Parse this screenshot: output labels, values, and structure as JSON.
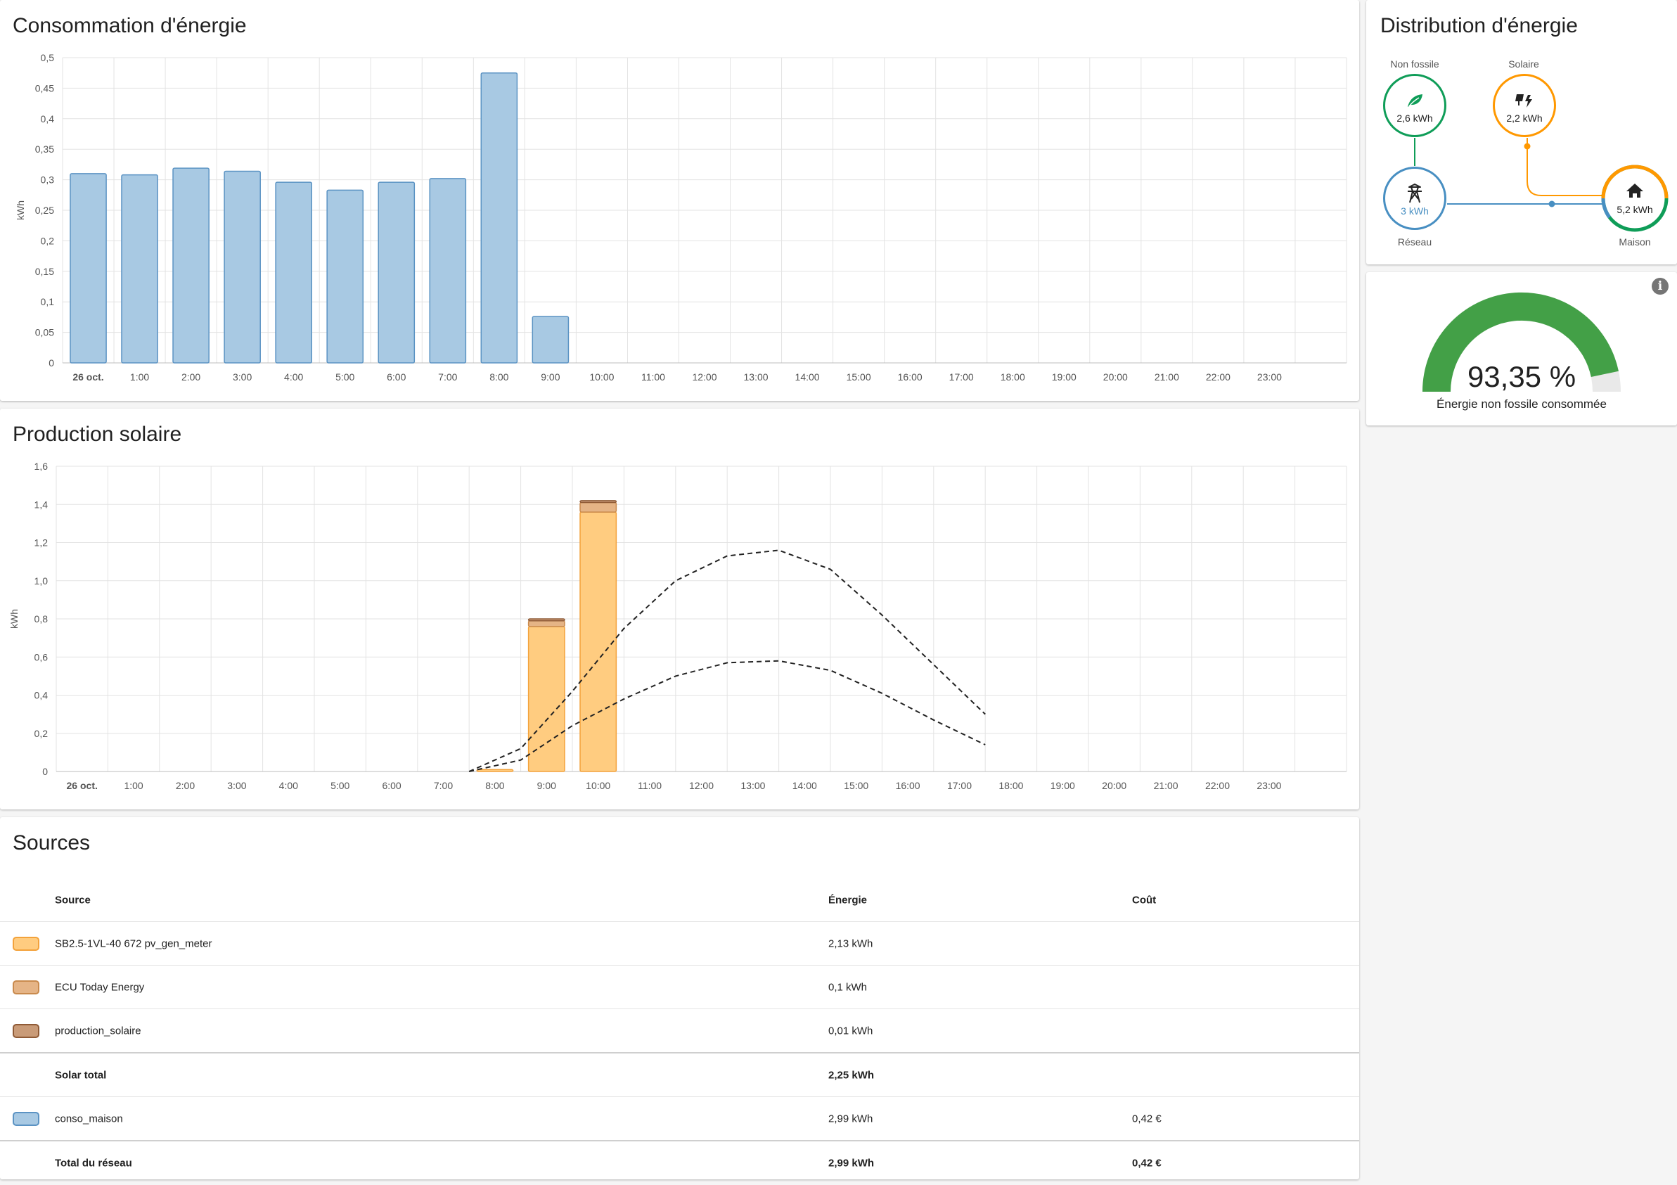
{
  "consumption": {
    "title": "Consommation d'énergie",
    "chart_data": {
      "type": "bar",
      "ylabel": "kWh",
      "ylim": [
        0,
        0.5
      ],
      "yticks": [
        "0",
        "0,05",
        "0,1",
        "0,15",
        "0,2",
        "0,25",
        "0,3",
        "0,35",
        "0,4",
        "0,45",
        "0,5"
      ],
      "categories": [
        "26 oct.",
        "1:00",
        "2:00",
        "3:00",
        "4:00",
        "5:00",
        "6:00",
        "7:00",
        "8:00",
        "9:00",
        "10:00",
        "11:00",
        "12:00",
        "13:00",
        "14:00",
        "15:00",
        "16:00",
        "17:00",
        "18:00",
        "19:00",
        "20:00",
        "21:00",
        "22:00",
        "23:00"
      ],
      "series": [
        {
          "name": "conso_maison",
          "values": [
            0.31,
            0.308,
            0.319,
            0.314,
            0.296,
            0.283,
            0.296,
            0.302,
            0.475,
            0.076,
            null,
            null,
            null,
            null,
            null,
            null,
            null,
            null,
            null,
            null,
            null,
            null,
            null,
            null
          ]
        }
      ],
      "grid": true,
      "colors": {
        "fill": "#a8c9e3",
        "stroke": "#5b93c3"
      }
    }
  },
  "solar": {
    "title": "Production solaire",
    "chart_data": {
      "type": "bar",
      "stacked": true,
      "ylabel": "kWh",
      "ylim": [
        0,
        1.6
      ],
      "yticks": [
        "0",
        "0,2",
        "0,4",
        "0,6",
        "0,8",
        "1,0",
        "1,2",
        "1,4",
        "1,6"
      ],
      "categories": [
        "26 oct.",
        "1:00",
        "2:00",
        "3:00",
        "4:00",
        "5:00",
        "6:00",
        "7:00",
        "8:00",
        "9:00",
        "10:00",
        "11:00",
        "12:00",
        "13:00",
        "14:00",
        "15:00",
        "16:00",
        "17:00",
        "18:00",
        "19:00",
        "20:00",
        "21:00",
        "22:00",
        "23:00"
      ],
      "series": [
        {
          "name": "SB2.5-1VL-40 672 pv_gen_meter",
          "values": [
            0,
            0,
            0,
            0,
            0,
            0,
            0,
            0,
            0.01,
            0.76,
            1.36,
            0,
            0,
            0,
            0,
            0,
            0,
            0,
            0,
            0,
            0,
            0,
            0,
            0
          ],
          "fill": "#ffcc80",
          "stroke": "#f3a23b"
        },
        {
          "name": "ECU Today Energy",
          "values": [
            0,
            0,
            0,
            0,
            0,
            0,
            0,
            0,
            0,
            0.03,
            0.05,
            0,
            0,
            0,
            0,
            0,
            0,
            0,
            0,
            0,
            0,
            0,
            0,
            0
          ],
          "fill": "#e5b486",
          "stroke": "#c98a4d"
        },
        {
          "name": "production_solaire",
          "values": [
            0,
            0,
            0,
            0,
            0,
            0,
            0,
            0,
            0,
            0.01,
            0.01,
            0,
            0,
            0,
            0,
            0,
            0,
            0,
            0,
            0,
            0,
            0,
            0,
            0
          ],
          "fill": "#c99b78",
          "stroke": "#8f5a36"
        }
      ],
      "forecast_lines": [
        {
          "style": "dashed",
          "x": [
            8,
            9,
            10,
            11,
            12,
            13,
            14,
            15,
            16,
            17,
            18
          ],
          "y": [
            0.0,
            0.12,
            0.42,
            0.75,
            1.0,
            1.13,
            1.16,
            1.06,
            0.82,
            0.56,
            0.3
          ]
        },
        {
          "style": "dashed",
          "x": [
            8,
            9,
            10,
            11,
            12,
            13,
            14,
            15,
            16,
            17,
            18
          ],
          "y": [
            0.0,
            0.06,
            0.24,
            0.38,
            0.5,
            0.57,
            0.58,
            0.53,
            0.41,
            0.27,
            0.14
          ]
        }
      ],
      "grid": true
    }
  },
  "sources": {
    "title": "Sources",
    "headers": {
      "source": "Source",
      "energy": "Énergie",
      "cost": "Coût"
    },
    "rows": [
      {
        "swatch_fill": "#ffcc80",
        "swatch_stroke": "#f3a23b",
        "name": "SB2.5-1VL-40 672 pv_gen_meter",
        "energy": "2,13 kWh",
        "cost": ""
      },
      {
        "swatch_fill": "#e5b486",
        "swatch_stroke": "#c98a4d",
        "name": "ECU Today Energy",
        "energy": "0,1 kWh",
        "cost": ""
      },
      {
        "swatch_fill": "#c99b78",
        "swatch_stroke": "#8f5a36",
        "name": "production_solaire",
        "energy": "0,01 kWh",
        "cost": ""
      }
    ],
    "solar_total": {
      "name": "Solar total",
      "energy": "2,25 kWh",
      "cost": ""
    },
    "grid_rows": [
      {
        "swatch_fill": "#a8c9e3",
        "swatch_stroke": "#5b93c3",
        "name": "conso_maison",
        "energy": "2,99 kWh",
        "cost": "0,42 €"
      }
    ],
    "grid_total": {
      "name": "Total du réseau",
      "energy": "2,99 kWh",
      "cost": "0,42 €"
    }
  },
  "distribution": {
    "title": "Distribution d'énergie",
    "non_fossil": {
      "label": "Non fossile",
      "value": "2,6 kWh",
      "icon": "leaf-icon",
      "color": "#0f9d58"
    },
    "solar": {
      "label": "Solaire",
      "value": "2,2 kWh",
      "icon": "solar-panel-icon",
      "color": "#ff9800"
    },
    "grid": {
      "label": "Réseau",
      "value": "3 kWh",
      "icon": "transmission-tower-icon",
      "color": "#488fc2"
    },
    "home": {
      "label": "Maison",
      "value": "5,2 kWh",
      "icon": "home-icon"
    }
  },
  "gauge": {
    "value_text": "93,35 %",
    "value": 93.35,
    "label": "Énergie non fossile consommée",
    "color": "#43a047",
    "icon": "info-icon"
  }
}
